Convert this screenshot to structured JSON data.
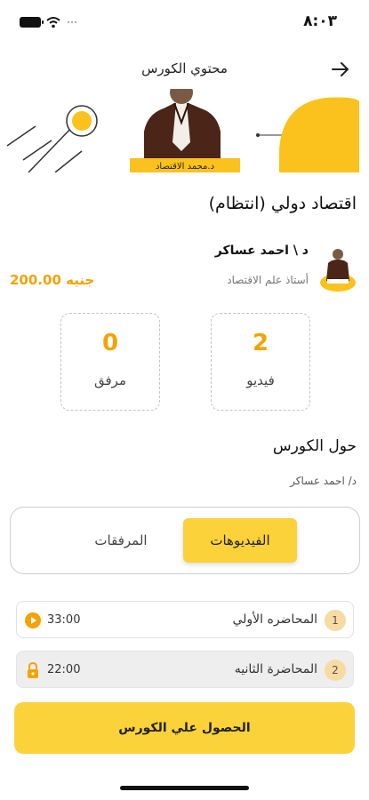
{
  "status_bar": {
    "time": "٨:٠٣",
    "wifi_icon": "wifi-icon",
    "battery_icon": "battery-icon"
  },
  "header": {
    "title": "محتوي الكورس",
    "back_icon": "arrow-right-icon"
  },
  "banner": {
    "caption": "د.محمد الاقتصاد"
  },
  "course": {
    "title": "اقتصاد دولي (انتظام)"
  },
  "instructor": {
    "name": "د \\ احمد عساكر",
    "role": "أستاذ علم الاقتصاد",
    "price": "200.00 جنيه"
  },
  "stats": {
    "videos": {
      "value": "2",
      "label": "فيديو"
    },
    "attachments": {
      "value": "0",
      "label": "مرفق"
    }
  },
  "about": {
    "title": "حول الكورس",
    "author": "د/ احمد عساكر"
  },
  "tabs": {
    "videos": "الفيديوهات",
    "attachments": "المرفقات",
    "active": "videos"
  },
  "lectures": [
    {
      "number": "1",
      "title": "المحاضره الأولي",
      "duration": "33:00",
      "icon": "play-icon",
      "locked": false
    },
    {
      "number": "2",
      "title": "المحاضرة الثانيه",
      "duration": "22:00",
      "icon": "lock-icon",
      "locked": true
    }
  ],
  "cta": {
    "label": "الحصول علي الكورس"
  },
  "colors": {
    "accent": "#fbd239",
    "price": "#f5a300"
  }
}
